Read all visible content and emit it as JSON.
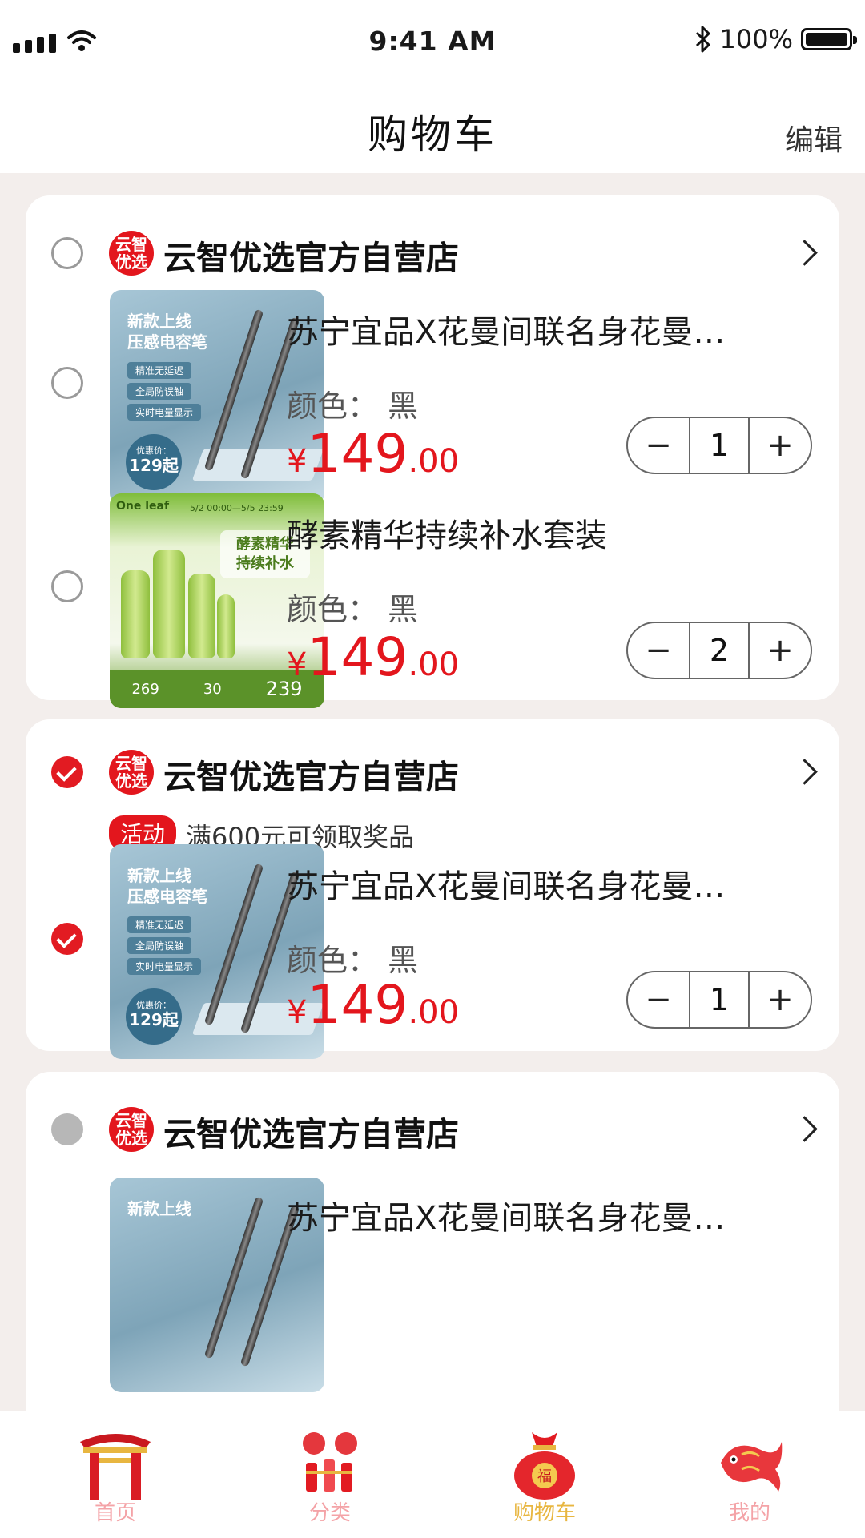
{
  "status_bar": {
    "time": "9:41 AM",
    "battery": "100%"
  },
  "header": {
    "title": "购物车",
    "edit_label": "编辑"
  },
  "stores": [
    {
      "logo_text": "云智优选",
      "name": "云智优选官方自营店",
      "checked": false,
      "items": [
        {
          "title": "苏宁宜品X花曼间联名身花曼…",
          "spec": "颜色： 黑",
          "price_currency": "¥",
          "price_int": "149",
          "price_dec": ".00",
          "quantity": "1",
          "checked": false,
          "image": {
            "headline_1": "新款上线",
            "headline_2": "压感电容笔",
            "tags": [
              "精准无延迟",
              "全局防误触",
              "实时电量显示"
            ],
            "badge_label": "优惠价：",
            "badge_price": "129起"
          }
        },
        {
          "title": "酵素精华持续补水套装",
          "spec": "颜色： 黑",
          "price_currency": "¥",
          "price_int": "149",
          "price_dec": ".00",
          "quantity": "2",
          "checked": false,
          "image": {
            "brand": "One leaf",
            "date": "5/2 00:00—5/5 23:59",
            "headline_1": "酵素精华",
            "headline_2": "持续补水",
            "p1": "269",
            "p2": "30",
            "p3": "239"
          }
        }
      ]
    },
    {
      "logo_text": "云智优选",
      "name": "云智优选官方自营店",
      "checked": true,
      "promo_badge": "活动",
      "promo_text": "满600元可领取奖品",
      "items": [
        {
          "title": "苏宁宜品X花曼间联名身花曼…",
          "spec": "颜色： 黑",
          "price_currency": "¥",
          "price_int": "149",
          "price_dec": ".00",
          "quantity": "1",
          "checked": true,
          "image": {
            "headline_1": "新款上线",
            "headline_2": "压感电容笔",
            "tags": [
              "精准无延迟",
              "全局防误触",
              "实时电量显示"
            ],
            "badge_label": "优惠价：",
            "badge_price": "129起"
          }
        }
      ]
    },
    {
      "logo_text": "云智优选",
      "name": "云智优选官方自营店",
      "disabled": true,
      "items": [
        {
          "title": "苏宁宜品X花曼间联名身花曼…",
          "image": {
            "headline_1": "新款上线"
          }
        }
      ]
    }
  ],
  "tabs": [
    {
      "label": "首页",
      "icon": "gate-icon",
      "active": false
    },
    {
      "label": "分类",
      "icon": "firecracker-icon",
      "active": false
    },
    {
      "label": "购物车",
      "icon": "lucky-bag-icon",
      "active": true
    },
    {
      "label": "我的",
      "icon": "koi-fish-icon",
      "active": false
    }
  ],
  "colors": {
    "accent": "#e3161d",
    "background": "#f3eeec",
    "active_tab": "#e8b640",
    "inactive_tab": "#f4a3a7"
  }
}
